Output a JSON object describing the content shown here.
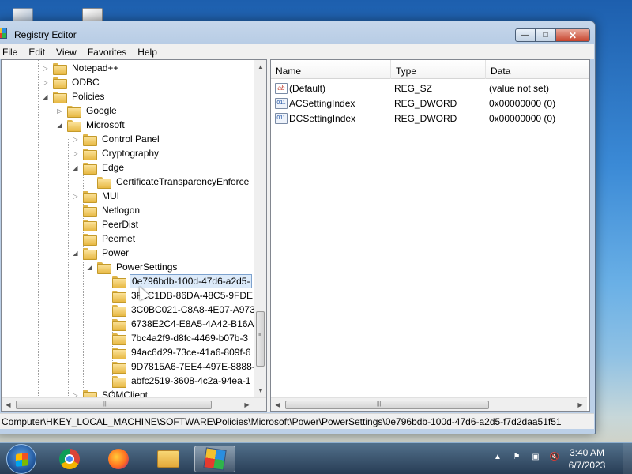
{
  "window": {
    "title": "Registry Editor",
    "controls": {
      "minimize": "—",
      "maximize": "□",
      "close": "✕"
    }
  },
  "menu": [
    "File",
    "Edit",
    "View",
    "Favorites",
    "Help"
  ],
  "tree": {
    "items": [
      {
        "label": "Notepad++",
        "expander": "▷"
      },
      {
        "label": "ODBC",
        "expander": "▷"
      },
      {
        "label": "Policies",
        "expander": "◢"
      },
      {
        "label": "Google",
        "expander": "▷"
      },
      {
        "label": "Microsoft",
        "expander": "◢"
      },
      {
        "label": "Control Panel",
        "expander": "▷"
      },
      {
        "label": "Cryptography",
        "expander": "▷"
      },
      {
        "label": "Edge",
        "expander": "◢"
      },
      {
        "label": "CertificateTransparencyEnforce",
        "expander": ""
      },
      {
        "label": "MUI",
        "expander": "▷"
      },
      {
        "label": "Netlogon",
        "expander": ""
      },
      {
        "label": "PeerDist",
        "expander": ""
      },
      {
        "label": "Peernet",
        "expander": ""
      },
      {
        "label": "Power",
        "expander": "◢"
      },
      {
        "label": "PowerSettings",
        "expander": "◢"
      },
      {
        "label": "0e796bdb-100d-47d6-a2d5-",
        "expander": "",
        "selected": true
      },
      {
        "label": "3F6C1DB-86DA-48C5-9FDE",
        "expander": ""
      },
      {
        "label": "3C0BC021-C8A8-4E07-A973",
        "expander": ""
      },
      {
        "label": "6738E2C4-E8A5-4A42-B16A-",
        "expander": ""
      },
      {
        "label": "7bc4a2f9-d8fc-4469-b07b-3",
        "expander": ""
      },
      {
        "label": "94ac6d29-73ce-41a6-809f-6",
        "expander": ""
      },
      {
        "label": "9D7815A6-7EE4-497E-8888-5",
        "expander": ""
      },
      {
        "label": "abfc2519-3608-4c2a-94ea-1",
        "expander": ""
      },
      {
        "label": "SQMClient",
        "expander": "▷"
      }
    ]
  },
  "list": {
    "columns": [
      "Name",
      "Type",
      "Data"
    ],
    "rows": [
      {
        "icon": "ab",
        "name": "(Default)",
        "type": "REG_SZ",
        "data": "(value not set)"
      },
      {
        "icon": "011",
        "name": "ACSettingIndex",
        "type": "REG_DWORD",
        "data": "0x00000000 (0)"
      },
      {
        "icon": "011",
        "name": "DCSettingIndex",
        "type": "REG_DWORD",
        "data": "0x00000000 (0)"
      }
    ]
  },
  "status_path": "Computer\\HKEY_LOCAL_MACHINE\\SOFTWARE\\Policies\\Microsoft\\Power\\PowerSettings\\0e796bdb-100d-47d6-a2d5-f7d2daa51f51",
  "scroll_glyphs": {
    "up": "▲",
    "down": "▼",
    "left": "◀",
    "right": "▶",
    "grip": "≡",
    "hgrip": "|||"
  },
  "taskbar": {
    "apps": [
      "Google Chrome",
      "Firefox",
      "File Explorer",
      "Registry Editor"
    ],
    "tray_icons": [
      "▲",
      "⚑",
      "▣",
      "🔇"
    ],
    "clock_time": "3:40 AM",
    "clock_date": "6/7/2023"
  }
}
